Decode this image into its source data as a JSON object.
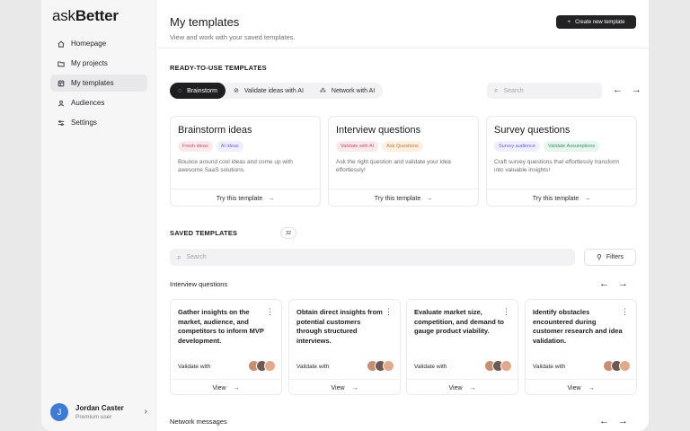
{
  "brand": {
    "ask": "ask",
    "better": "Better"
  },
  "nav": [
    {
      "label": "Homepage",
      "icon": "home-icon"
    },
    {
      "label": "My projects",
      "icon": "folder-icon"
    },
    {
      "label": "My templates",
      "icon": "templates-icon",
      "active": true
    },
    {
      "label": "Audiences",
      "icon": "audience-icon"
    },
    {
      "label": "Settings",
      "icon": "settings-icon"
    }
  ],
  "user": {
    "initial": "J",
    "name": "Jordan Caster",
    "role": "Premium user"
  },
  "header": {
    "title": "My templates",
    "subtitle": "View and work with your saved templates.",
    "create_label": "Create new template"
  },
  "ready": {
    "label": "READY-TO-USE TEMPLATES",
    "tabs": [
      "Brainstorm",
      "Validate ideas with AI",
      "Network with AI"
    ],
    "search_placeholder": "Search",
    "cards": [
      {
        "title": "Brainstorm ideas",
        "tags": [
          "Fresh ideas",
          "AI ideas"
        ],
        "desc": "Bounce around cool ideas and come up with awesome SaaS solutions.",
        "cta": "Try this template"
      },
      {
        "title": "Interview questions",
        "tags": [
          "Validate with AI",
          "Ask Questions"
        ],
        "desc": "Ask the right question and validate your idea effortlessly!",
        "cta": "Try this template"
      },
      {
        "title": "Survey questions",
        "tags": [
          "Survey audience",
          "Validate Assumptions"
        ],
        "desc": "Craft survey questions that effortlessly transform into valuable insights!",
        "cta": "Try this template"
      }
    ]
  },
  "saved": {
    "label": "SAVED TEMPLATES",
    "count": "32",
    "search_placeholder": "Search",
    "filters_label": "Filters",
    "group_title": "Interview questions",
    "cards": [
      {
        "title": "Gather insights on the market, audience, and competitors to inform MVP development.",
        "validate": "Validate with",
        "cta": "View"
      },
      {
        "title": "Obtain direct insights from potential customers through structured interviews.",
        "validate": "Validate with",
        "cta": "View"
      },
      {
        "title": "Evaluate market size, competition, and demand to gauge product viability.",
        "validate": "Validate with",
        "cta": "View"
      },
      {
        "title": "Identify obstacles encountered during customer research and idea validation.",
        "validate": "Validate with",
        "cta": "View"
      }
    ],
    "next_group_title": "Network messages"
  }
}
